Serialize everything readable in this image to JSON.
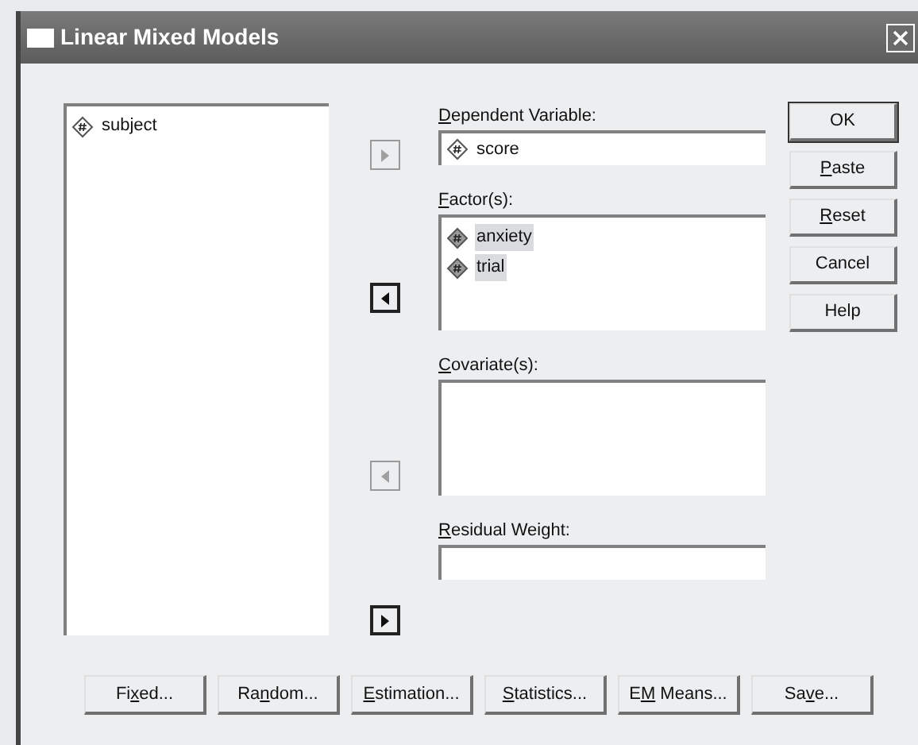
{
  "window": {
    "title": "Linear Mixed Models"
  },
  "source_list": {
    "items": [
      {
        "label": "subject",
        "selected": false
      }
    ]
  },
  "targets": [
    {
      "kind": "field",
      "arrow": {
        "kind": "right",
        "disabled": true
      },
      "label": {
        "key": "D",
        "after": "ependent Variable:"
      },
      "items": [
        {
          "label": "score",
          "selected": false
        }
      ]
    },
    {
      "kind": "list",
      "arrow": {
        "kind": "left",
        "disabled": false
      },
      "label": {
        "key": "F",
        "after": "actor(s):"
      },
      "items": [
        {
          "label": "anxiety",
          "selected": true
        },
        {
          "label": "trial",
          "selected": true
        }
      ]
    },
    {
      "kind": "list",
      "arrow": {
        "kind": "left",
        "disabled": true
      },
      "label": {
        "key": "C",
        "after": "ovariate(s):"
      }
    },
    {
      "kind": "field",
      "arrow": {
        "kind": "right",
        "disabled": false
      },
      "label": {
        "key": "R",
        "after": "esidual Weight:"
      }
    }
  ],
  "side_buttons": [
    {
      "before": "OK"
    },
    {
      "key": "P",
      "after": "aste"
    },
    {
      "key": "R",
      "after": "eset"
    },
    {
      "before": "Cancel"
    },
    {
      "before": "Help"
    }
  ],
  "bottom_buttons": [
    {
      "before": "Fi",
      "key": "x",
      "after": "ed..."
    },
    {
      "before": "Ra",
      "key": "n",
      "after": "dom..."
    },
    {
      "key": "E",
      "after": "stimation..."
    },
    {
      "key": "S",
      "after": "tatistics..."
    },
    {
      "before": "E",
      "key": "M",
      "after": " Means..."
    },
    {
      "before": "Sa",
      "key": "v",
      "after": "e..."
    }
  ]
}
